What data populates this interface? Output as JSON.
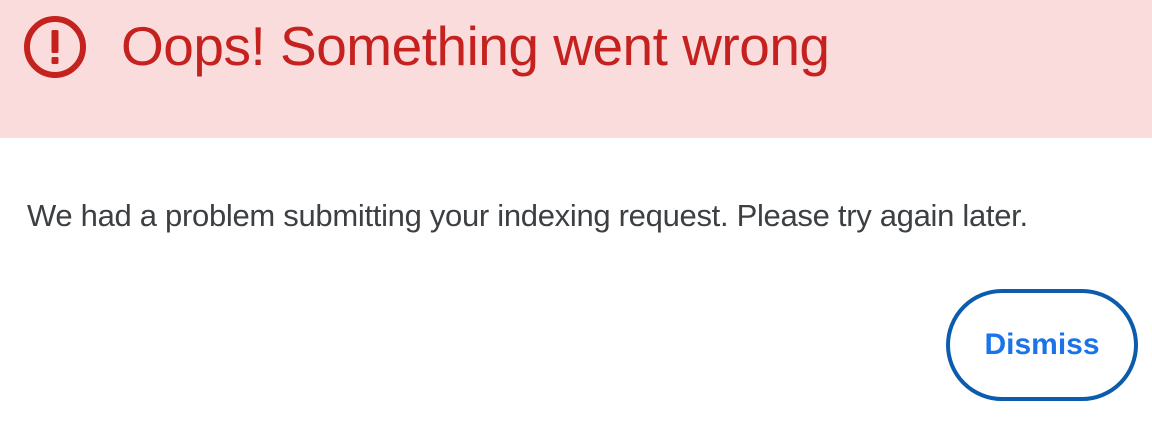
{
  "dialog": {
    "title": "Oops! Something went wrong",
    "icon": "error-exclamation-circle-icon",
    "message": "We had a problem submitting your indexing request. Please try again later.",
    "dismiss_label": "Dismiss"
  },
  "colors": {
    "header_background": "#fadcdc",
    "error_red": "#c5221f",
    "message_text": "#3c4043",
    "button_text": "#1a73e8",
    "button_border": "#0b5cad"
  }
}
